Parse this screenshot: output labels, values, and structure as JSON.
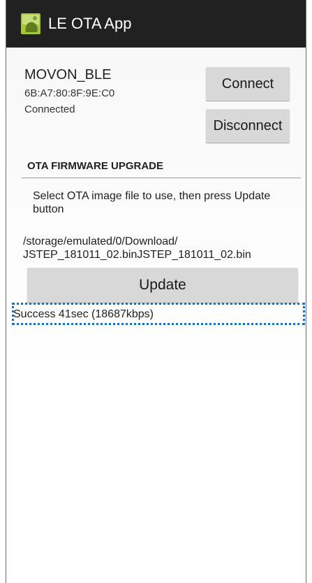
{
  "app": {
    "title": "LE OTA App"
  },
  "device": {
    "name": "MOVON_BLE",
    "address": "6B:A7:80:8F:9E:C0",
    "status": "Connected"
  },
  "buttons": {
    "connect": "Connect",
    "disconnect": "Disconnect",
    "update": "Update"
  },
  "ota": {
    "header": "OTA FIRMWARE UPGRADE",
    "instructions": "Select OTA image file to use, then press Update button",
    "file_path": "/storage/emulated/0/Download/\nJSTEP_181011_02.binJSTEP_181011_02.bin",
    "result": "Success 41sec (18687kbps)"
  },
  "colors": {
    "action_bar": "#212121",
    "button": "#d8d8d8",
    "highlight": "#1f6fb3",
    "android_green": "#a4c639"
  },
  "icons": {
    "app": "android-app-icon"
  }
}
